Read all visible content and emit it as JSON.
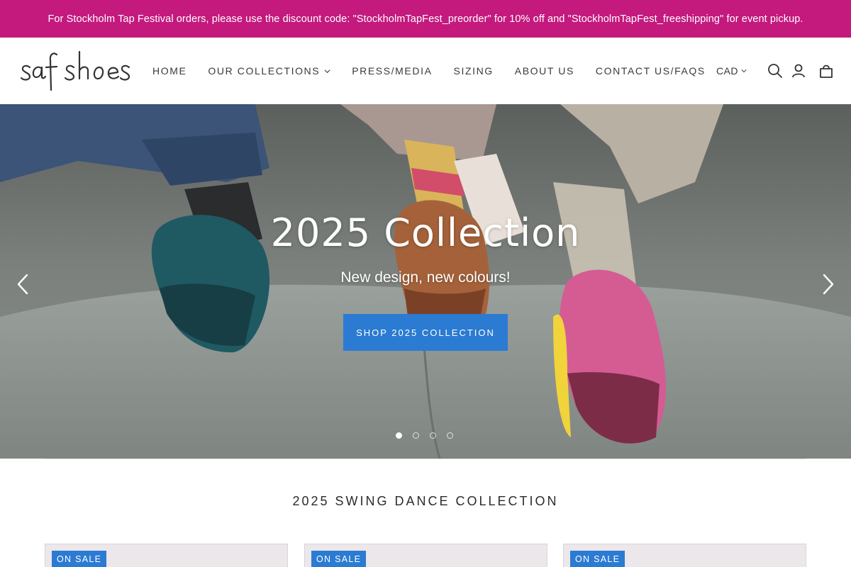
{
  "announcement": {
    "text": "For Stockholm Tap Festival orders, please use the discount code: \"StockholmTapFest_preorder\" for 10% off and \"StockholmTapFest_freeshipping\" for event pickup.",
    "bg_color": "#c4197d"
  },
  "header": {
    "logo_text": "saf shoes",
    "nav": [
      {
        "label": "HOME",
        "has_dropdown": false
      },
      {
        "label": "OUR COLLECTIONS",
        "has_dropdown": true
      },
      {
        "label": "PRESS/MEDIA",
        "has_dropdown": false
      },
      {
        "label": "SIZING",
        "has_dropdown": false
      },
      {
        "label": "ABOUT US",
        "has_dropdown": false
      },
      {
        "label": "CONTACT US/FAQS",
        "has_dropdown": false
      }
    ],
    "currency": "CAD",
    "icons": [
      "search-icon",
      "account-icon",
      "cart-icon"
    ]
  },
  "hero": {
    "title": "2025 Collection",
    "subtitle": "New design, new colours!",
    "button_label": "SHOP 2025 COLLECTION",
    "button_color": "#2b7bd2",
    "slide_count": 4,
    "active_slide": 1
  },
  "section": {
    "title": "2025 SWING DANCE COLLECTION"
  },
  "products": [
    {
      "badge": "ON SALE"
    },
    {
      "badge": "ON SALE"
    },
    {
      "badge": "ON SALE"
    }
  ]
}
